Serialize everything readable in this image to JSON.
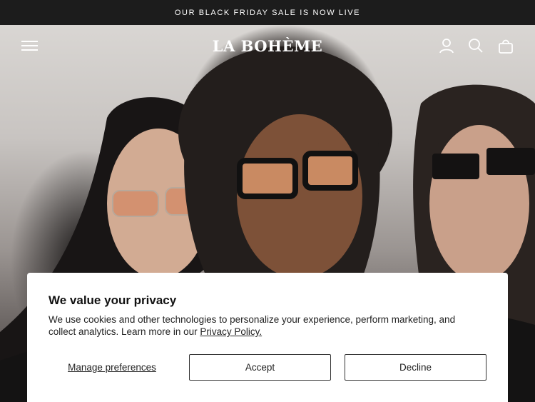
{
  "announcement": {
    "text": "OUR BLACK FRIDAY SALE IS NOW LIVE"
  },
  "header": {
    "logo": "LA BOHÈME",
    "icons": [
      "menu-icon",
      "account-icon",
      "search-icon",
      "cart-icon"
    ]
  },
  "cookie_banner": {
    "title": "We value your privacy",
    "body": "We use cookies and other technologies to personalize your experience, perform marketing, and collect analytics. Learn more in our ",
    "policy_link": "Privacy Policy.",
    "manage_label": "Manage preferences",
    "accept_label": "Accept",
    "decline_label": "Decline"
  },
  "colors": {
    "announcement_bg": "#1c1c1c",
    "banner_bg": "#ffffff",
    "text": "#222222"
  }
}
